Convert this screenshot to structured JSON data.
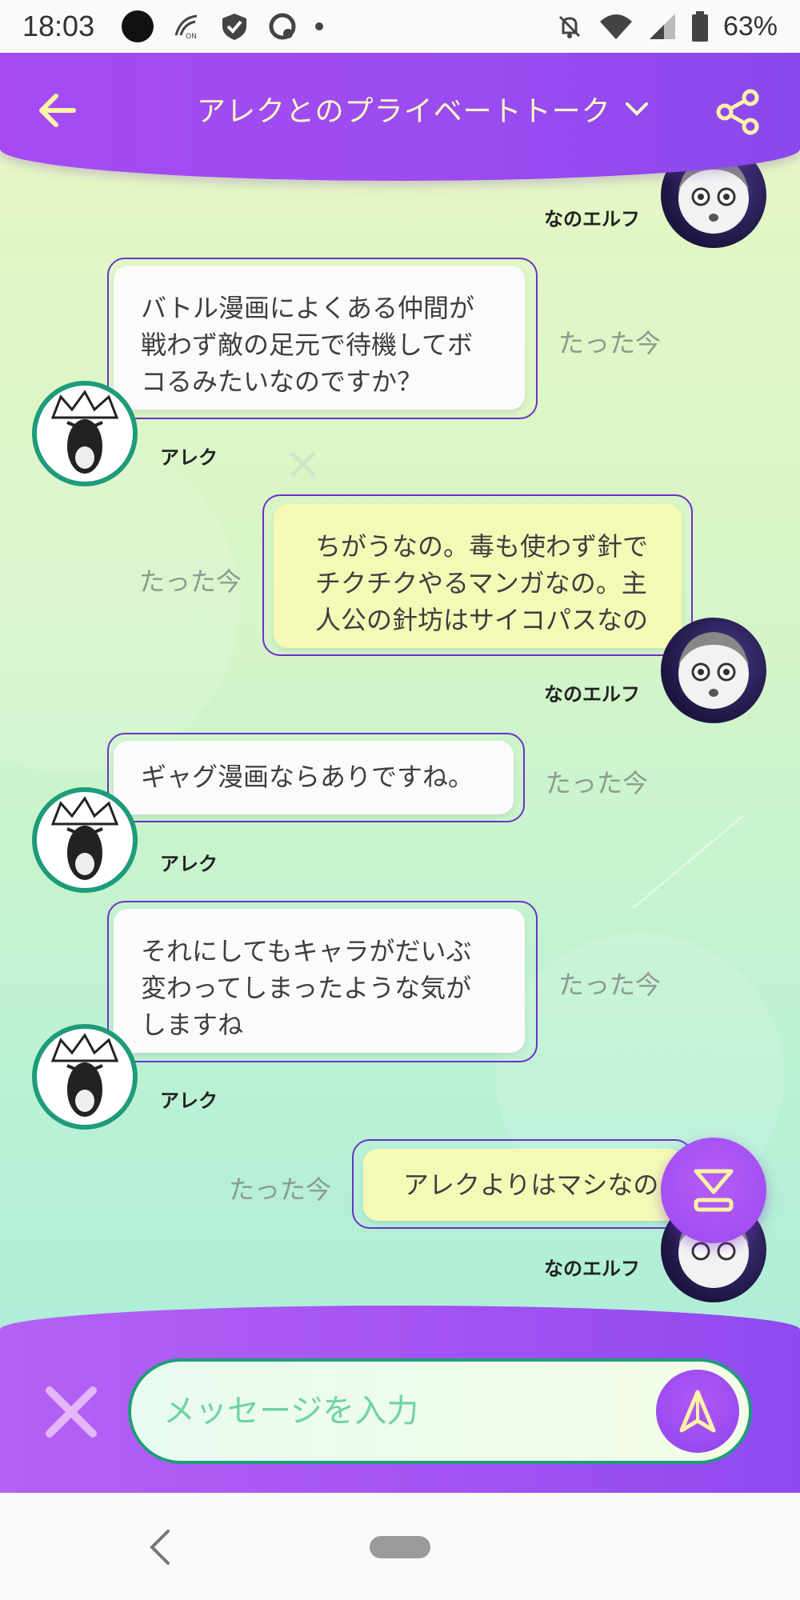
{
  "status_bar": {
    "time": "18:03",
    "battery": "63%",
    "left_icons": [
      "dark-circle-icon",
      "nfc-on-icon",
      "shield-check-icon",
      "sync-icon",
      "notification-dot-icon"
    ],
    "right_icons": [
      "mute-bell-icon",
      "wifi-icon",
      "cell-signal-icon",
      "battery-icon"
    ]
  },
  "header": {
    "title": "アレクとのプライベートトーク",
    "back_icon": "arrow-left-icon",
    "dropdown_icon": "chevron-down-icon",
    "share_icon": "share-icon"
  },
  "messages": [
    {
      "sender": "なのエルフ",
      "side": "right",
      "text": "",
      "time": ""
    },
    {
      "sender": "アレク",
      "side": "left",
      "text": "バトル漫画によくある仲間が\n戦わず敵の足元で待機してボ\nコるみたいなのですか？",
      "time": "たった今"
    },
    {
      "sender": "なのエルフ",
      "side": "right",
      "text": "ちがうなの。毒も使わず針で\nチクチクやるマンガなの。主\n人公の針坊はサイコパスなの",
      "time": "たった今"
    },
    {
      "sender": "アレク",
      "side": "left",
      "text": "ギャグ漫画ならありですね。",
      "time": "たった今"
    },
    {
      "sender": "アレク",
      "side": "left",
      "text": "それにしてもキャラがだいぶ\n変わってしまったような気が\nしますね",
      "time": "たった今"
    },
    {
      "sender": "なのエルフ",
      "side": "right",
      "text": "アレクよりはマシなの",
      "time": "たった今"
    }
  ],
  "input": {
    "placeholder": "メッセージを入力",
    "value": "",
    "send_icon": "send-arrow-icon",
    "clear_icon": "close-x-icon"
  },
  "fab": {
    "icon": "scroll-to-bottom-icon"
  },
  "nav": {
    "back_icon": "nav-back-icon",
    "home_icon": "nav-home-pill-icon"
  },
  "colors": {
    "header": "#9a4cf0",
    "accent_green": "#1e9b7a",
    "bubble_outline": "#6a32c8",
    "bubble_right": "#f4fab6",
    "bubble_left": "#fbfbfb",
    "header_text": "#fff8c8"
  }
}
